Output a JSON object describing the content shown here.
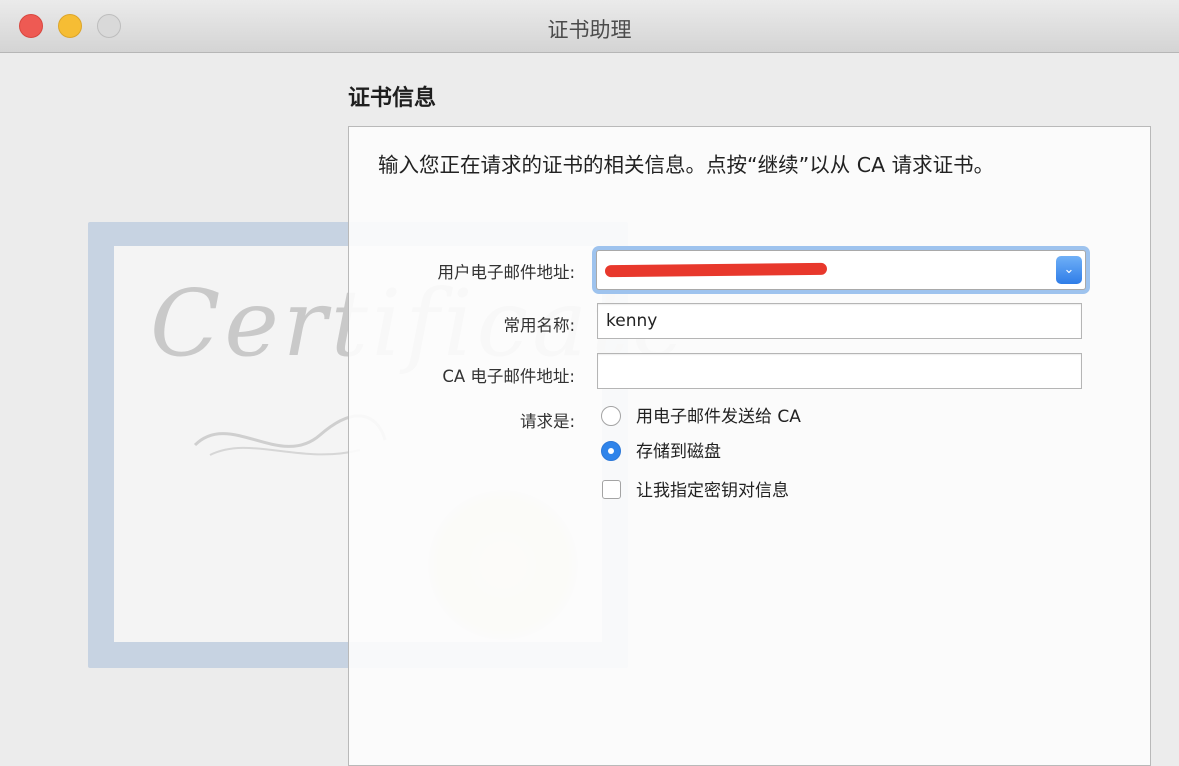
{
  "window": {
    "title": "证书助理",
    "traffic_colors": {
      "close": "#ee5a53",
      "minimize": "#f6bd34",
      "zoom": "#d9d9d9"
    }
  },
  "section": {
    "title": "证书信息",
    "instructions": "输入您正在请求的证书的相关信息。点按“继续”以从 CA 请求证书。"
  },
  "artwork": {
    "script_text": "Certificate"
  },
  "form": {
    "email_label": "用户电子邮件地址:",
    "email_value_redacted": true,
    "common_name_label": "常用名称:",
    "common_name_value": "kenny",
    "ca_email_label": "CA 电子邮件地址:",
    "ca_email_value": "",
    "request_label": "请求是:",
    "options": [
      {
        "label": "用电子邮件发送给 CA",
        "selected": false
      },
      {
        "label": "存储到磁盘",
        "selected": true
      }
    ],
    "key_checkbox_label": "让我指定密钥对信息",
    "key_checkbox_checked": false
  }
}
